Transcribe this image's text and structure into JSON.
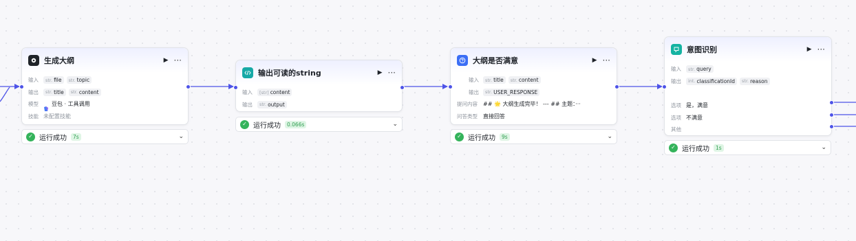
{
  "labels": {
    "input": "输入",
    "output": "输出",
    "model": "模型",
    "skill": "技能",
    "ask_content": "提问内容",
    "answer_type": "问答类型",
    "option": "选项",
    "other": "其他"
  },
  "type_prefix": {
    "str": "str.",
    "list": "[str]",
    "int": "int."
  },
  "icons": {
    "play": "▶",
    "more": "···",
    "chevron": "⌄",
    "check": "✓"
  },
  "colors": {
    "accent": "#4d53e8",
    "success": "#34b35b",
    "llm_icon": "#1f2329",
    "code_icon": "#17a9a6",
    "question_icon": "#3b6ef5",
    "intent_icon": "#15b3a2"
  },
  "nodes": {
    "outline": {
      "title": "生成大纲",
      "inputs": [
        "file",
        "topic"
      ],
      "outputs": [
        "title",
        "content"
      ],
      "model": "豆包 · 工具调用",
      "skill": "未配置技能",
      "status": "运行成功",
      "duration": "7s"
    },
    "code": {
      "title": "输出可读的string",
      "inputs": [
        "content"
      ],
      "outputs": [
        "output"
      ],
      "status": "运行成功",
      "duration": "0.066s"
    },
    "question": {
      "title": "大纲是否满意",
      "inputs": [
        "title",
        "content"
      ],
      "outputs": [
        "USER_RESPONSE"
      ],
      "ask_content": "## 🌟 大纲生成完毕！ --- ## 主题：···",
      "answer_type": "直接回答",
      "status": "运行成功",
      "duration": "9s"
    },
    "intent": {
      "title": "意图识别",
      "inputs": [
        "query"
      ],
      "outputs": [
        "classificationId",
        "reason"
      ],
      "options": [
        "是，满意",
        "不满意"
      ],
      "status": "运行成功",
      "duration": "1s"
    }
  }
}
